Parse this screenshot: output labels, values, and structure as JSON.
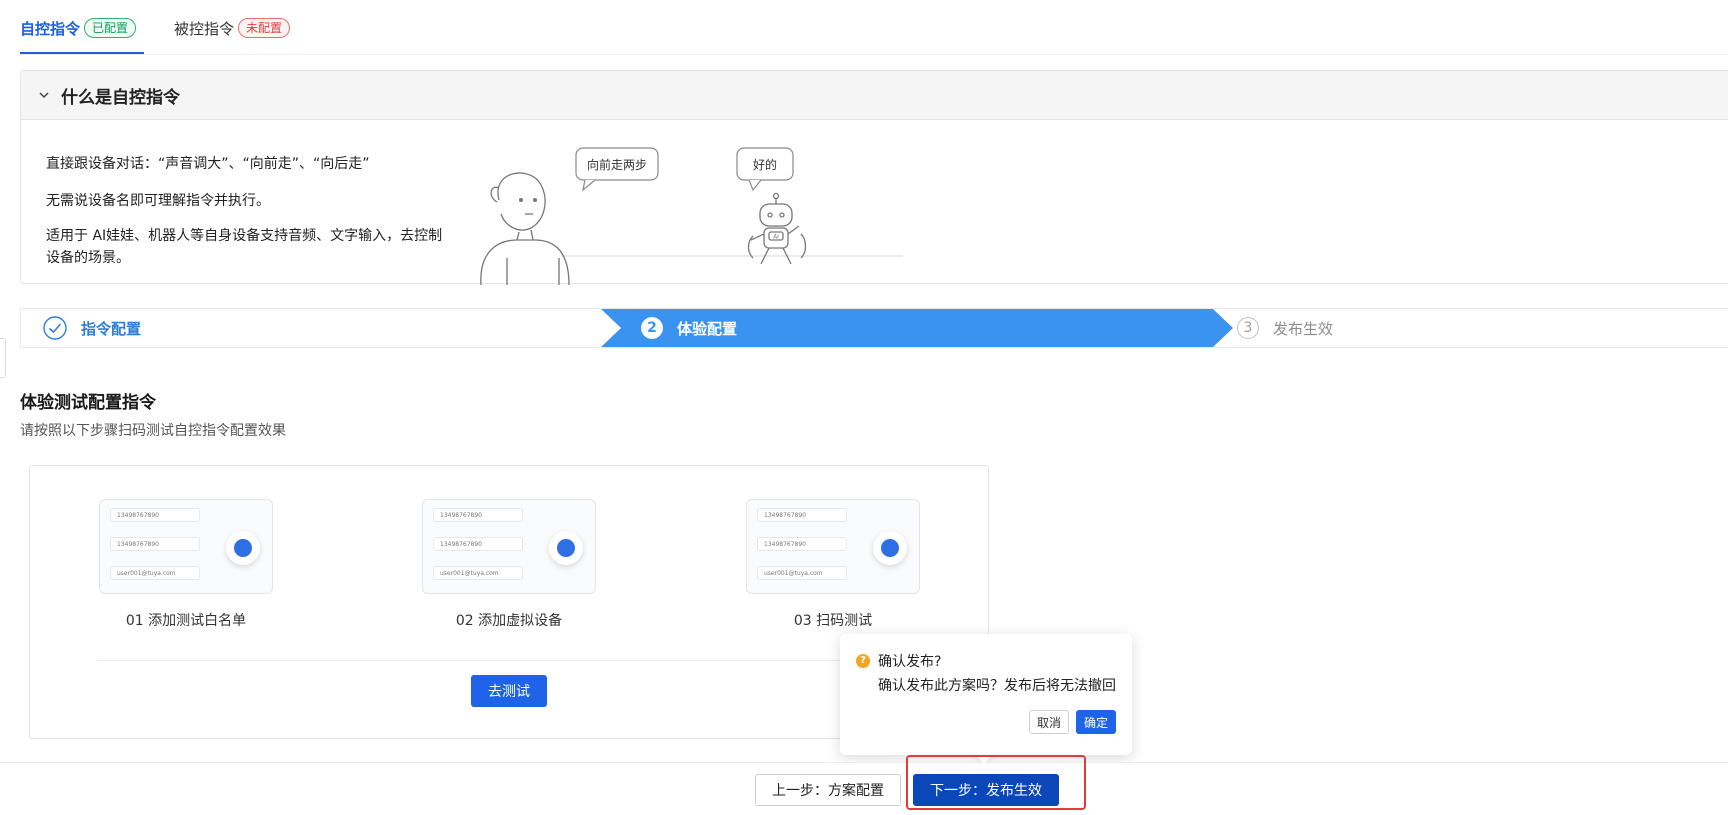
{
  "tabs": [
    {
      "label": "自控指令",
      "badge": "已配置"
    },
    {
      "label": "被控指令",
      "badge": "未配置"
    }
  ],
  "panel": {
    "title": "什么是自控指令",
    "lines": [
      "直接跟设备对话：“声音调大”、“向前走”、“向后走”",
      "无需说设备名即可理解指令并执行。",
      "适用于 AI娃娃、机器人等自身设备支持音频、文字输入，去控制设备的场景。"
    ],
    "bubble_human": "向前走两步",
    "bubble_robot": "好的",
    "robot_chest_label": "AI"
  },
  "steps": [
    {
      "num": "1",
      "label": "指令配置",
      "state": "done"
    },
    {
      "num": "2",
      "label": "体验配置",
      "state": "active"
    },
    {
      "num": "3",
      "label": "发布生效",
      "state": "pending"
    }
  ],
  "section": {
    "title": "体验测试配置指令",
    "desc": "请按照以下步骤扫码测试自控指令配置效果"
  },
  "guide": [
    {
      "caption": "01 添加测试白名单",
      "rows": [
        "13498767890",
        "13498767890",
        "user001@tuya.com"
      ]
    },
    {
      "caption": "02 添加虚拟设备",
      "rows": [
        "13498767890",
        "13498767890",
        "user001@tuya.com"
      ]
    },
    {
      "caption": "03 扫码测试",
      "rows": [
        "13498767890",
        "13498767890",
        "user001@tuya.com"
      ]
    }
  ],
  "test_button": "去测试",
  "popconfirm": {
    "icon": "?",
    "title": "确认发布?",
    "desc": "确认发布此方案吗？发布后将无法撤回",
    "cancel": "取消",
    "ok": "确定"
  },
  "footer": {
    "prev": "上一步：方案配置",
    "next": "下一步：发布生效"
  },
  "colors": {
    "primary": "#1e63e8",
    "step_active": "#3a93ef",
    "success": "#2bb673",
    "danger": "#e03c3c",
    "warning": "#f5a524",
    "highlight": "#e23b3b"
  }
}
